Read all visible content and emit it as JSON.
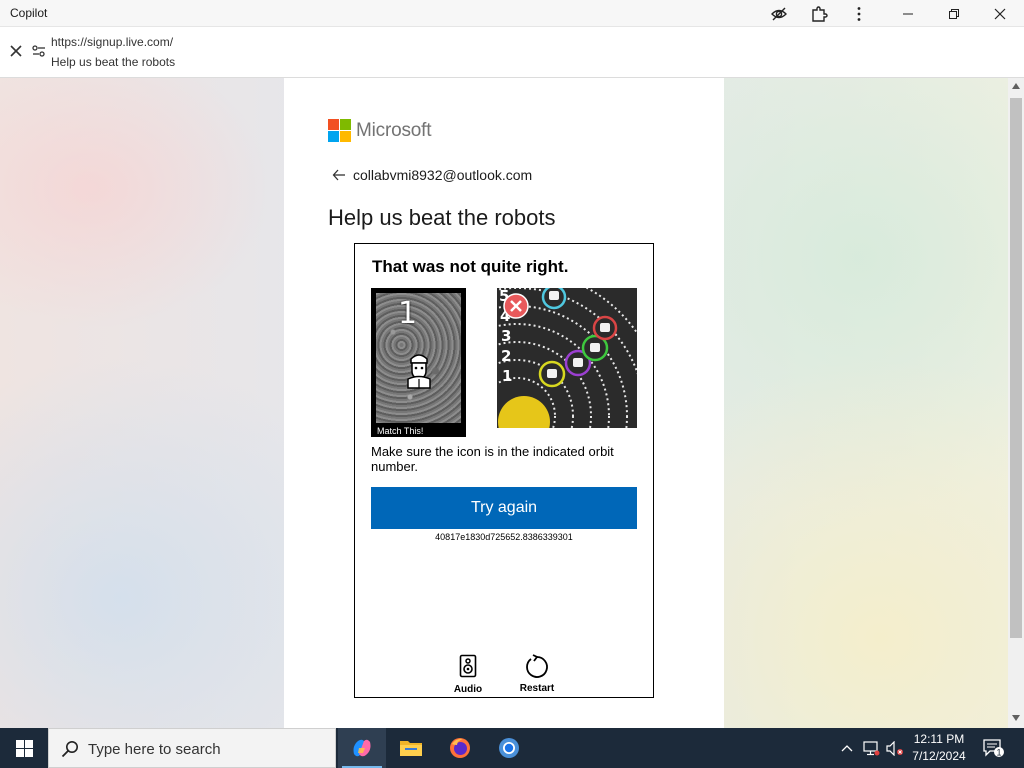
{
  "window": {
    "title": "Copilot"
  },
  "address": {
    "url": "https://signup.live.com/",
    "page_title": "Help us beat the robots"
  },
  "page": {
    "brand": "Microsoft",
    "brand_colors": [
      "#f25022",
      "#7fba00",
      "#00a4ef",
      "#ffb900"
    ],
    "account_email": "collabvmi8932@outlook.com",
    "heading": "Help us beat the robots"
  },
  "challenge": {
    "title": "That was not quite right.",
    "match_number": "1",
    "match_caption": "Match This!",
    "orbit_labels": [
      "5",
      "4",
      "3",
      "2",
      "1"
    ],
    "instruction": "Make sure the icon is in the indicated orbit number.",
    "try_again_label": "Try again",
    "session_id": "40817e1830d725652.8386339301",
    "audio_label": "Audio",
    "restart_label": "Restart",
    "accent_color": "#0067b8"
  },
  "taskbar": {
    "search_placeholder": "Type here to search",
    "apps": [
      "copilot-icon",
      "file-explorer-icon",
      "firefox-icon",
      "chrome-icon"
    ],
    "time": "12:11 PM",
    "date": "7/12/2024",
    "notification_count": "1"
  }
}
